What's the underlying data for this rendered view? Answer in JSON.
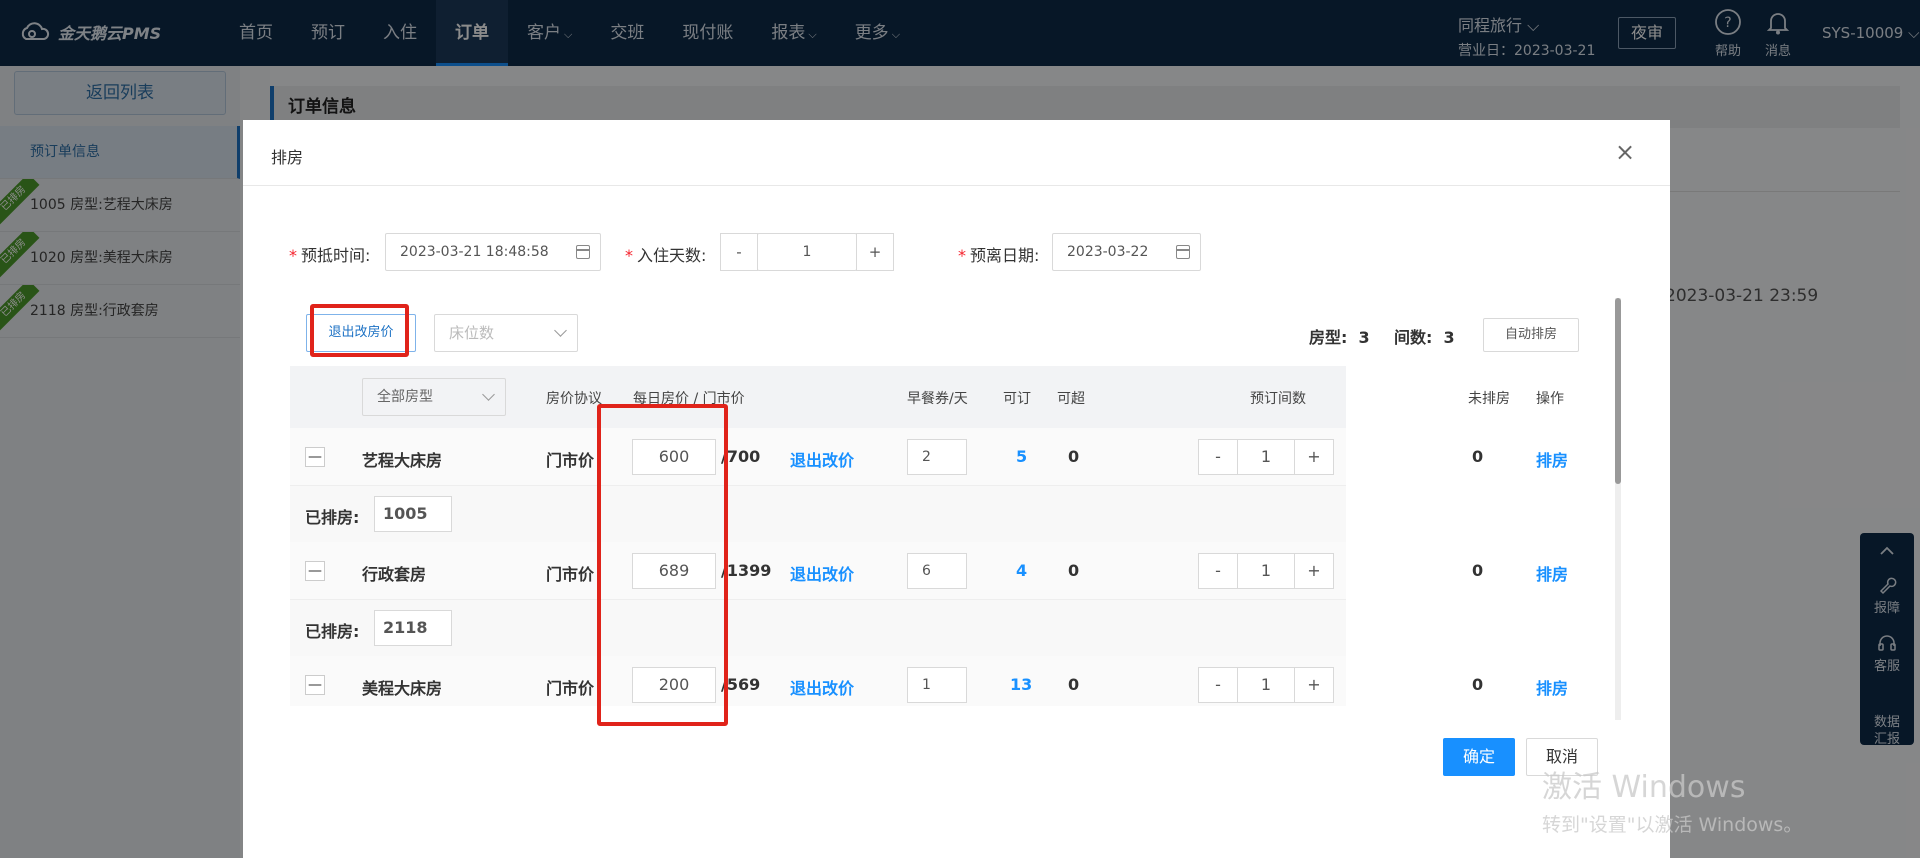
{
  "app": {
    "logo_text": "金天鹅云PMS"
  },
  "nav": {
    "items": [
      {
        "label": "首页"
      },
      {
        "label": "预订"
      },
      {
        "label": "入住"
      },
      {
        "label": "订单"
      },
      {
        "label": "客户",
        "chevron": "⌵"
      },
      {
        "label": "交班"
      },
      {
        "label": "现付账"
      },
      {
        "label": "报表",
        "chevron": "⌵"
      },
      {
        "label": "更多",
        "chevron": "⌵"
      }
    ],
    "active_index": 3
  },
  "header": {
    "hotel_name": "同程旅行 ⌵",
    "business_date": "营业日：2023-03-21",
    "night_audit": "夜审",
    "help": "帮助",
    "messages": "消息",
    "user": "SYS-10009 ⌵"
  },
  "sidebar": {
    "back_label": "返回列表",
    "items": [
      {
        "label": "预订单信息"
      },
      {
        "label": "1005  房型:艺程大床房",
        "ribbon": "已排房"
      },
      {
        "label": "1020  房型:美程大床房",
        "ribbon": "已排房"
      },
      {
        "label": "2118  房型:行政套房",
        "ribbon": "已排房"
      }
    ]
  },
  "background": {
    "section_title": "订单信息",
    "date_text": "2023-03-21 23:59"
  },
  "modal": {
    "title": "排房",
    "close": "×",
    "checkin_label": "预抵时间:",
    "checkin_value": "2023-03-21 18:48:58",
    "nights_label": "入住天数:",
    "nights_minus": "-",
    "nights_value": "1",
    "nights_plus": "+",
    "checkout_label": "预离日期:",
    "checkout_value": "2023-03-22",
    "exit_change_price": "退出改房价",
    "bed_count_placeholder": "床位数",
    "room_type_summary_label": "房型:",
    "room_type_summary_value": "3",
    "room_count_summary_label": "间数:",
    "room_count_summary_value": "3",
    "auto_assign": "自动排房",
    "table": {
      "room_type_filter": "全部房型",
      "headers": {
        "agreement": "房价协议",
        "price": "每日房价 / 门市价",
        "breakfast": "早餐券/天",
        "available": "可订",
        "overbook": "可超",
        "count": "预订间数",
        "unassigned": "未排房",
        "action": "操作"
      },
      "rows": [
        {
          "collapse": "—",
          "room_type": "艺程大床房",
          "agreement": "门市价",
          "price": "600",
          "rack_price": "/700",
          "exit": "退出改价",
          "breakfast": "2",
          "available": "5",
          "overbook": "0",
          "minus": "-",
          "count": "1",
          "plus": "+",
          "unassigned": "0",
          "action": "排房",
          "assigned_label": "已排房:",
          "assigned_room": "1005"
        },
        {
          "collapse": "—",
          "room_type": "行政套房",
          "agreement": "门市价",
          "price": "689",
          "rack_price": "/1399",
          "exit": "退出改价",
          "breakfast": "6",
          "available": "4",
          "overbook": "0",
          "minus": "-",
          "count": "1",
          "plus": "+",
          "unassigned": "0",
          "action": "排房",
          "assigned_label": "已排房:",
          "assigned_room": "2118"
        },
        {
          "collapse": "—",
          "room_type": "美程大床房",
          "agreement": "门市价",
          "price": "200",
          "rack_price": "/569",
          "exit": "退出改价",
          "breakfast": "1",
          "available": "13",
          "overbook": "0",
          "minus": "-",
          "count": "1",
          "plus": "+",
          "unassigned": "0",
          "action": "排房"
        }
      ]
    },
    "confirm": "确定",
    "cancel": "取消"
  },
  "float_panel": {
    "items": [
      {
        "label": "报障",
        "icon": "wrench-icon"
      },
      {
        "label": "客服",
        "icon": "headset-icon"
      },
      {
        "label": "数据\n汇报",
        "icon": "report-icon"
      }
    ]
  },
  "watermark": {
    "line1": "激活 Windows",
    "line2": "转到\"设置\"以激活 Windows。"
  },
  "colors": {
    "nav_bg": "#0d2a47",
    "primary": "#1890ff",
    "annotation_red": "#e0231a",
    "ribbon_green": "#4c9a2a"
  }
}
